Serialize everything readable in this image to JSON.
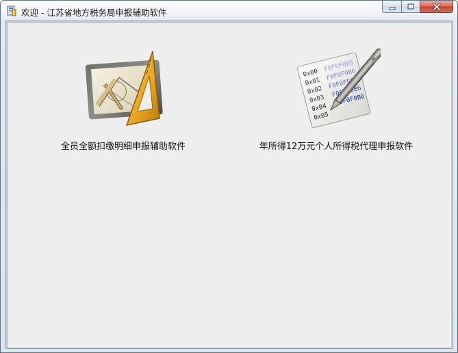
{
  "window": {
    "title": "欢迎 - 江苏省地方税务局申报辅助软件",
    "icon": "app-icon",
    "controls": {
      "minimize": "minimize-icon",
      "maximize": "maximize-icon",
      "close": "close-icon"
    }
  },
  "launcher": {
    "items": [
      {
        "label": "全员全额扣缴明细申报辅助软件",
        "icon": "drafting-tools-icon"
      },
      {
        "label": "年所得12万元个人所得税代理申报软件",
        "icon": "hex-document-pen-icon"
      }
    ]
  },
  "hex_sheet": {
    "offsets": [
      "0x00",
      "0x01",
      "0x02",
      "0x03",
      "0x04",
      "0x05"
    ],
    "values": [
      "F0F0F0B6",
      "F0F0F0B6",
      "F0F0FFFF",
      "F0F0F0B6",
      "F0F0F0B6"
    ]
  },
  "colors": {
    "client_bg": "#eeeeee",
    "close_button": "#c4432d",
    "frame_border": "#5f7283"
  }
}
